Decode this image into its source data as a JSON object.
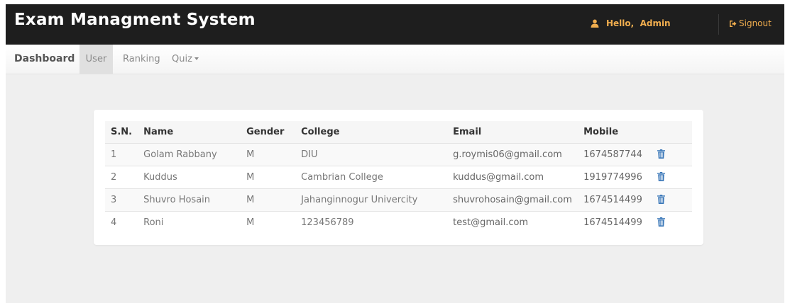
{
  "header": {
    "title": "Exam Managment System",
    "greeting": "Hello,  Admin",
    "signout_label": "Signout"
  },
  "nav": {
    "items": [
      {
        "label": "Dashboard"
      },
      {
        "label": "User"
      },
      {
        "label": "Ranking"
      },
      {
        "label": "Quiz"
      }
    ],
    "active": "User"
  },
  "table": {
    "columns": [
      "S.N.",
      "Name",
      "Gender",
      "College",
      "Email",
      "Mobile"
    ],
    "rows": [
      {
        "sn": "1",
        "name": "Golam Rabbany",
        "gender": "M",
        "college": "DIU",
        "email": "g.roymis06@gmail.com",
        "mobile": "1674587744"
      },
      {
        "sn": "2",
        "name": "Kuddus",
        "gender": "M",
        "college": "Cambrian College",
        "email": "kuddus@gmail.com",
        "mobile": "1919774996"
      },
      {
        "sn": "3",
        "name": "Shuvro Hosain",
        "gender": "M",
        "college": "Jahanginnogur Univercity",
        "email": "shuvrohosain@gmail.com",
        "mobile": "1674514499"
      },
      {
        "sn": "4",
        "name": "Roni",
        "gender": "M",
        "college": "123456789",
        "email": "test@gmail.com",
        "mobile": "1674514499"
      }
    ]
  },
  "icons": {
    "user": "user-icon",
    "signout": "signout-icon",
    "delete": "trash-icon",
    "dropdown": "caret-down-icon"
  },
  "colors": {
    "topbar": "#1e1e1e",
    "accent": "#f0ad4e",
    "trash": "#3a77b8",
    "background": "#efefef"
  }
}
